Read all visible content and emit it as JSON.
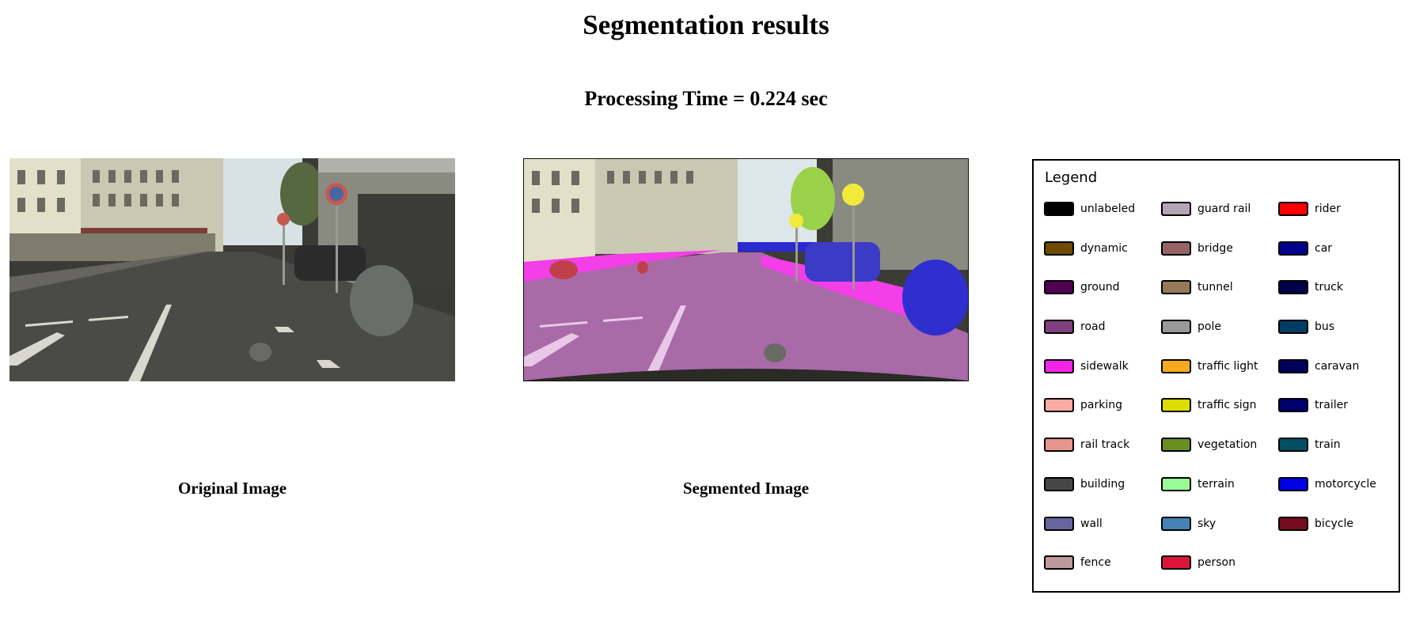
{
  "header": {
    "title": "Segmentation results",
    "processing_time": "Processing Time = 0.224 sec"
  },
  "images": {
    "original_caption": "Original Image",
    "segmented_caption": "Segmented Image"
  },
  "legend": {
    "title": "Legend",
    "items": [
      {
        "label": "unlabeled",
        "color": "#000000"
      },
      {
        "label": "guard rail",
        "color": "#B4A5B4"
      },
      {
        "label": "rider",
        "color": "#FF0000"
      },
      {
        "label": "dynamic",
        "color": "#6F4A00"
      },
      {
        "label": "bridge",
        "color": "#966464"
      },
      {
        "label": "car",
        "color": "#00008E"
      },
      {
        "label": "ground",
        "color": "#510051"
      },
      {
        "label": "tunnel",
        "color": "#96785A"
      },
      {
        "label": "truck",
        "color": "#000046"
      },
      {
        "label": "road",
        "color": "#804080"
      },
      {
        "label": "pole",
        "color": "#999999"
      },
      {
        "label": "bus",
        "color": "#003C64"
      },
      {
        "label": "sidewalk",
        "color": "#F423E8"
      },
      {
        "label": "traffic light",
        "color": "#FAAA1E"
      },
      {
        "label": "caravan",
        "color": "#00005A"
      },
      {
        "label": "parking",
        "color": "#FAAAA0"
      },
      {
        "label": "traffic sign",
        "color": "#DCDC00"
      },
      {
        "label": "trailer",
        "color": "#00006E"
      },
      {
        "label": "rail track",
        "color": "#E6968C"
      },
      {
        "label": "vegetation",
        "color": "#6B8E23"
      },
      {
        "label": "train",
        "color": "#005064"
      },
      {
        "label": "building",
        "color": "#464646"
      },
      {
        "label": "terrain",
        "color": "#98FB98"
      },
      {
        "label": "motorcycle",
        "color": "#0000E6"
      },
      {
        "label": "wall",
        "color": "#66669C"
      },
      {
        "label": "sky",
        "color": "#4682B4"
      },
      {
        "label": "bicycle",
        "color": "#770B20"
      },
      {
        "label": "fence",
        "color": "#BE9999"
      },
      {
        "label": "person",
        "color": "#DC143C"
      }
    ]
  }
}
